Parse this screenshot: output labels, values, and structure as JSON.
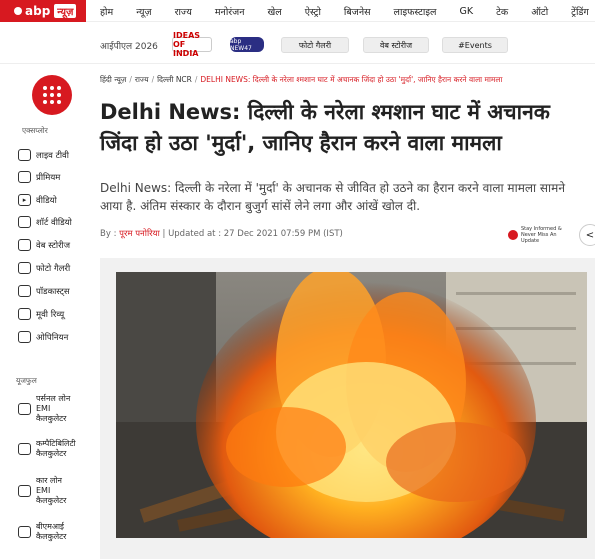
{
  "brand": {
    "abp": "abp",
    "news": "न्यूज़"
  },
  "topnav": [
    "होम",
    "न्यूज़",
    "राज्य",
    "मनोरंजन",
    "खेल",
    "ऐस्ट्रो",
    "बिजनेस",
    "लाइफस्टाइल",
    "GK",
    "टेक",
    "ऑटो",
    "ट्रेंडिंग"
  ],
  "subbar": {
    "ipl": "आईपीएल 2026",
    "ideas": "IDEAS OF INDIA",
    "network": "abp NEW47",
    "pills": [
      "फोटो गैलरी",
      "वेब स्टोरीज",
      "#Events"
    ]
  },
  "sidebar": {
    "explore_label": "एक्सप्लोर",
    "explore": [
      {
        "icon": "tv-icon",
        "label": "लाइव टीवी"
      },
      {
        "icon": "premium-icon",
        "label": "प्रीमियम"
      },
      {
        "icon": "video-icon",
        "label": "वीडियो"
      },
      {
        "icon": "short-video-icon",
        "label": "शॉर्ट वीडियो"
      },
      {
        "icon": "web-stories-icon",
        "label": "वेब स्टोरीज"
      },
      {
        "icon": "photo-gallery-icon",
        "label": "फोटो गैलरी"
      },
      {
        "icon": "podcast-icon",
        "label": "पॉडकास्ट्स"
      },
      {
        "icon": "movie-review-icon",
        "label": "मूवी रिव्यू"
      },
      {
        "icon": "opinion-icon",
        "label": "ओपिनियन"
      }
    ],
    "useful_label": "यूजफुल",
    "useful": [
      {
        "icon": "calculator-icon",
        "line1": "पर्सनल लोन",
        "line2": "EMI",
        "line3": "कैलकुलेटर"
      },
      {
        "icon": "calculator-icon",
        "line1": "कम्पैटिबिलिटी",
        "line2": "कैलकुलेटर",
        "line3": ""
      },
      {
        "icon": "calculator-icon",
        "line1": "कार लोन",
        "line2": "EMI",
        "line3": "कैलकुलेटर"
      },
      {
        "icon": "calculator-icon",
        "line1": "बीएमआई",
        "line2": "कैलकुलेटर",
        "line3": ""
      }
    ]
  },
  "breadcrumb": {
    "items": [
      "हिंदी न्यूज़",
      "राज्य",
      "दिल्ली NCR"
    ],
    "current": "DELHI NEWS: दिल्ली के नरेला श्मशान घाट में अचानक जिंदा हो उठा 'मुर्दा', जानिए हैरान करने वाला मामला"
  },
  "article": {
    "headline": "Delhi News: दिल्ली के नरेला श्मशान घाट में अचानक जिंदा हो उठा 'मुर्दा', जानिए हैरान करने वाला मामला",
    "summary_line1": "Delhi News: दिल्ली के नरेला में 'मुर्दा' के अचानक से जीवित हो उठने का हैरान करने वाला मामला सामने",
    "summary_line2": "आया है. अंतिम संस्कार के दौरान बुजुर्ग सांसें लेने लगा और आंखें खोल दी.",
    "by": "By :",
    "author": "पूरम पनोरिया",
    "updated": "| Updated at : 27 Dec 2021 07:59 PM (IST)",
    "stay_text_1": "Stay Informed &",
    "stay_text_2": "Never Miss An Update"
  },
  "colors": {
    "brand_red": "#d71920"
  }
}
